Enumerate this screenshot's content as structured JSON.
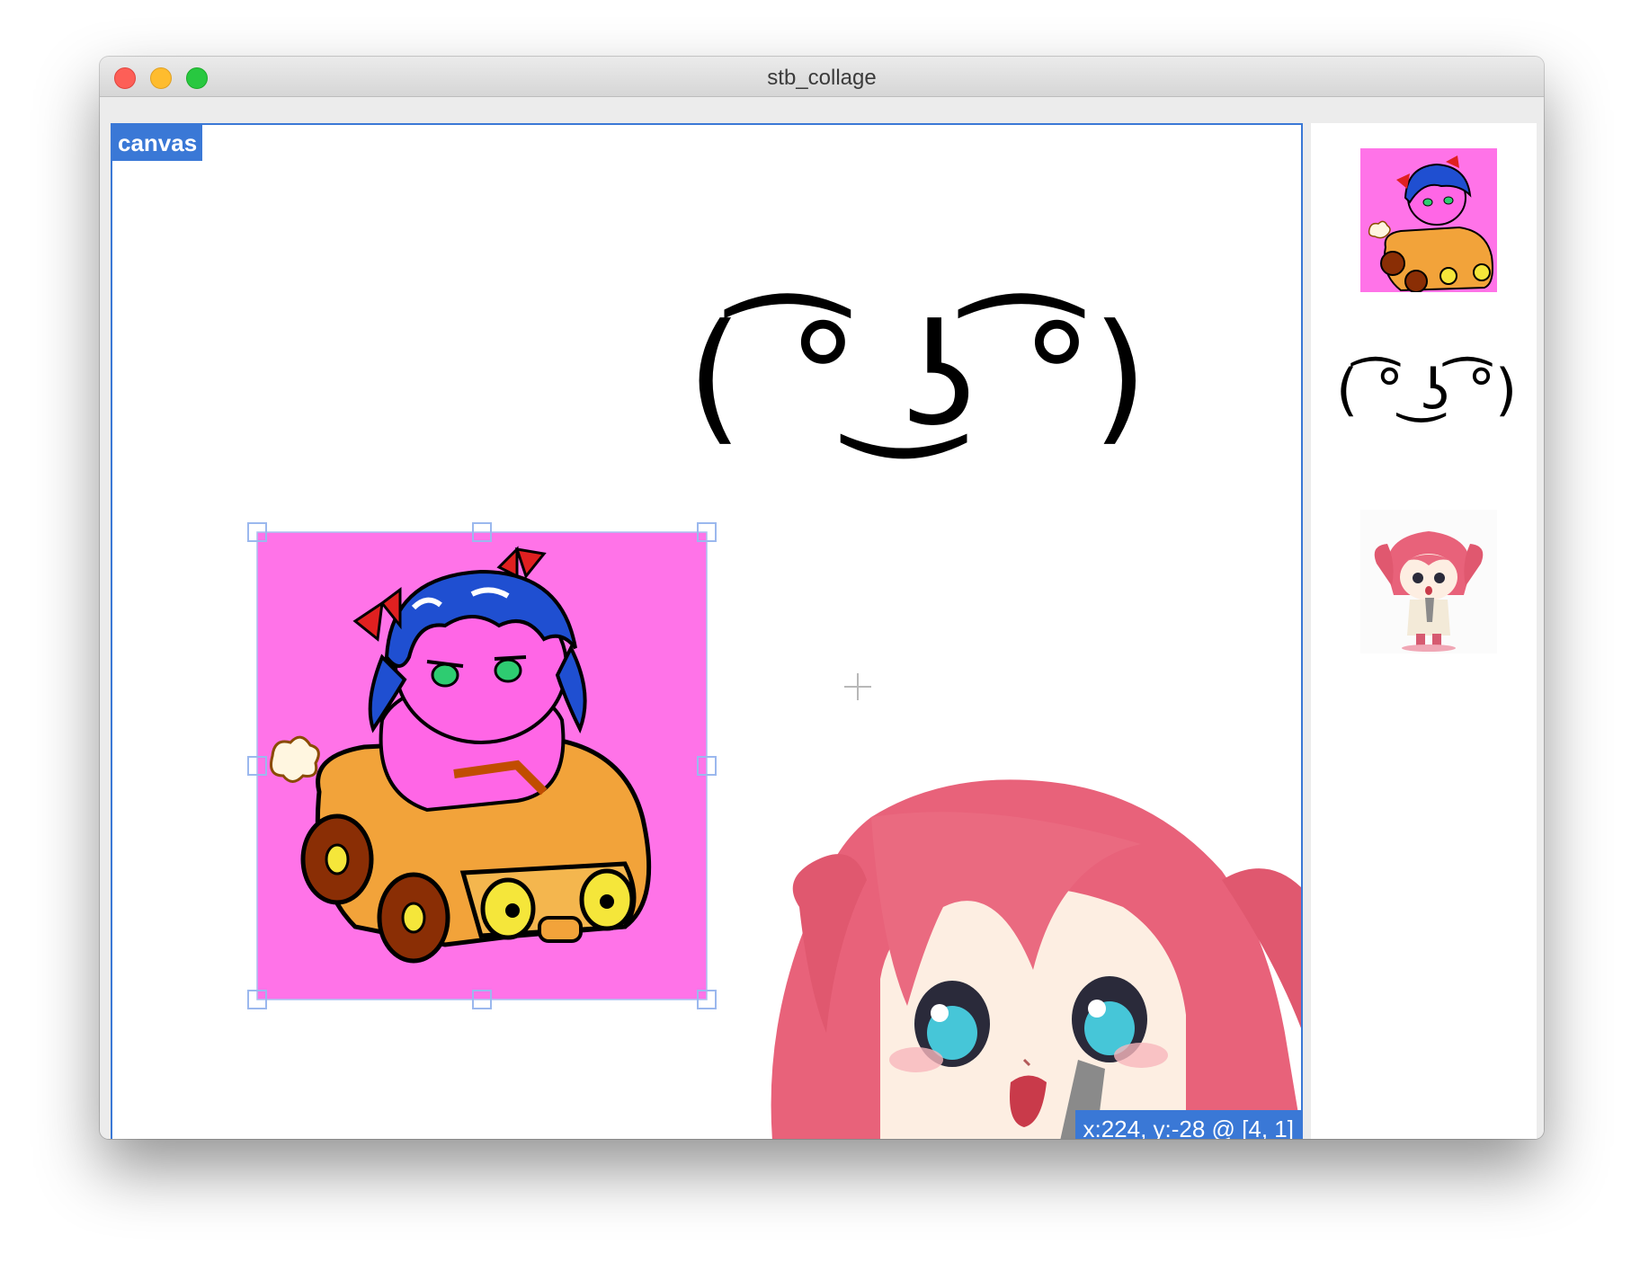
{
  "window": {
    "title": "stb_collage"
  },
  "canvas": {
    "label": "canvas",
    "status": "x:224, y:-28 @ [4, 1]",
    "lenny_text": "( ͡° ͜ʖ ͡°)"
  },
  "sidebar": {
    "lenny_text": "( ͡° ͜ʖ ͡°)"
  },
  "colors": {
    "accent": "#3a78d6",
    "pink_bg": "#ff73e8",
    "car_orange": "#f2a33a",
    "hair_blue": "#1f4fd1",
    "hair_red": "#e8627a"
  }
}
